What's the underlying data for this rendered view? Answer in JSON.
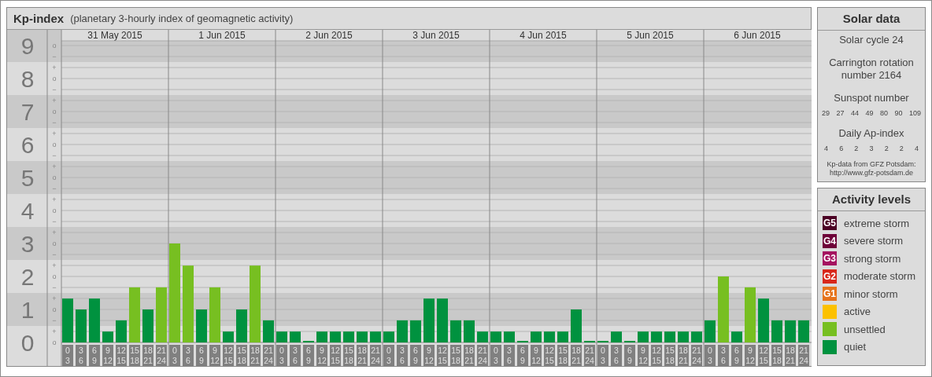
{
  "main_panel": {
    "title": "Kp-index",
    "subtitle": "(planetary 3-hourly index of geomagnetic activity)",
    "days": [
      "31 May 2015",
      "1 Jun 2015",
      "2 Jun 2015",
      "3 Jun 2015",
      "4 Jun 2015",
      "5 Jun 2015",
      "6 Jun 2015"
    ],
    "ytick_marks": [
      "o",
      "−",
      "+",
      "o",
      "−",
      "+",
      "o",
      "−",
      "+",
      "o",
      "−",
      "+",
      "o",
      "−",
      "+",
      "o",
      "−",
      "+",
      "o",
      "−",
      "+",
      "o",
      "−",
      "+",
      "o",
      "−",
      "+",
      "o"
    ],
    "chart_data": {
      "type": "bar",
      "grid": true,
      "ylim": [
        0,
        9
      ],
      "yticks": [
        0,
        1,
        2,
        3,
        4,
        5,
        6,
        7,
        8,
        9
      ],
      "categories": [
        "0 3",
        "3 6",
        "6 9",
        "9 12",
        "12 15",
        "15 18",
        "18 21",
        "21 24",
        "0 3",
        "3 6",
        "6 9",
        "9 12",
        "12 15",
        "15 18",
        "18 21",
        "21 24",
        "0 3",
        "3 6",
        "6 9",
        "9 12",
        "12 15",
        "15 18",
        "18 21",
        "21 24",
        "0 3",
        "3 6",
        "6 9",
        "9 12",
        "12 15",
        "15 18",
        "18 21",
        "21 24",
        "0 3",
        "3 6",
        "6 9",
        "9 12",
        "12 15",
        "15 18",
        "18 21",
        "21 24",
        "0 3",
        "3 6",
        "6 9",
        "9 12",
        "12 15",
        "15 18",
        "18 21",
        "21 24",
        "0 3",
        "3 6",
        "6 9",
        "9 12",
        "12 15",
        "15 18",
        "18 21",
        "21 24"
      ],
      "series": [
        {
          "color": "#00923f",
          "values": [
            1.33,
            1,
            1.33,
            0.33,
            0.67,
            null,
            1,
            null,
            null,
            null,
            1,
            null,
            0.33,
            1,
            null,
            0.67,
            0.33,
            0.33,
            0,
            0.33,
            0.33,
            0.33,
            0.33,
            0.33,
            0.33,
            0.67,
            0.67,
            1.33,
            1.33,
            0.67,
            0.67,
            0.33,
            0.33,
            0.33,
            0,
            0.33,
            0.33,
            0.33,
            1,
            0,
            0,
            0.33,
            0,
            0.33,
            0.33,
            0.33,
            0.33,
            0.33,
            0.67,
            null,
            0.33,
            null,
            1.33,
            0.67,
            0.67,
            0.67
          ]
        },
        {
          "color": "#77bf21",
          "values": [
            null,
            null,
            null,
            null,
            null,
            1.67,
            null,
            1.67,
            3,
            2.33,
            null,
            1.67,
            null,
            null,
            2.33,
            null,
            null,
            null,
            null,
            null,
            null,
            null,
            null,
            null,
            null,
            null,
            null,
            null,
            null,
            null,
            null,
            null,
            null,
            null,
            null,
            null,
            null,
            null,
            null,
            null,
            null,
            null,
            null,
            null,
            null,
            null,
            null,
            null,
            null,
            2,
            null,
            1.67,
            null,
            null,
            null,
            null
          ]
        }
      ]
    }
  },
  "solar_data": {
    "title": "Solar data",
    "solar_cycle": "Solar cycle 24",
    "carrington_rotation": [
      "Carrington rotation",
      "number 2164"
    ],
    "sunspot_label": "Sunspot number",
    "sunspot_numbers": [
      "29",
      "27",
      "44",
      "49",
      "80",
      "90",
      "109"
    ],
    "ap_label": "Daily Ap-index",
    "ap_values": [
      "4",
      "6",
      "2",
      "3",
      "2",
      "2",
      "4"
    ],
    "source": [
      "Kp-data from GFZ Potsdam:",
      "http://www.gfz-potsdam.de"
    ]
  },
  "activity_levels": {
    "title": "Activity levels",
    "items": [
      {
        "badge": "G5",
        "label": "extreme storm",
        "color": "#4b0024"
      },
      {
        "badge": "G4",
        "label": "severe storm",
        "color": "#6e0038"
      },
      {
        "badge": "G3",
        "label": "strong storm",
        "color": "#a5135f"
      },
      {
        "badge": "G2",
        "label": "moderate storm",
        "color": "#d8281b"
      },
      {
        "badge": "G1",
        "label": "minor storm",
        "color": "#e6731b"
      },
      {
        "label": "active",
        "color": "#fcc100"
      },
      {
        "label": "unsettled",
        "color": "#77bf21"
      },
      {
        "label": "quiet",
        "color": "#00923f"
      }
    ]
  }
}
